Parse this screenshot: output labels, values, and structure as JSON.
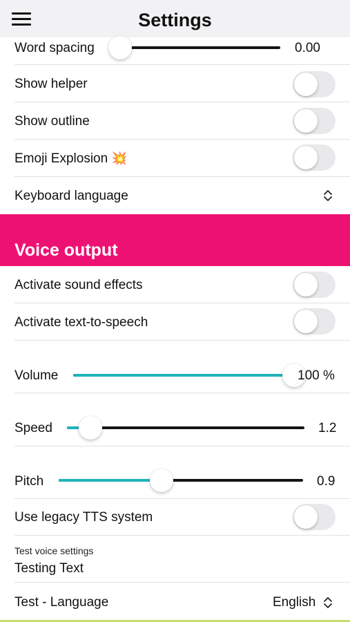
{
  "header": {
    "title": "Settings",
    "menu_icon": "hamburger-menu-icon"
  },
  "display": {
    "word_spacing": {
      "label": "Word spacing",
      "value_text": "0.00",
      "fraction": 0.05
    },
    "show_helper": {
      "label": "Show helper",
      "on": false
    },
    "show_outline": {
      "label": "Show outline",
      "on": false
    },
    "emoji_explosion": {
      "label": "Emoji Explosion",
      "emoji": "💥",
      "on": false
    },
    "keyboard_language": {
      "label": "Keyboard language",
      "value": ""
    }
  },
  "voice_output": {
    "section_title": "Voice output",
    "sound_effects": {
      "label": "Activate sound effects",
      "on": false
    },
    "tts": {
      "label": "Activate text-to-speech",
      "on": false
    },
    "volume": {
      "label": "Volume",
      "value_text": "100 %",
      "fraction": 1.0
    },
    "speed": {
      "label": "Speed",
      "value_text": "1.2",
      "fraction": 0.1
    },
    "pitch": {
      "label": "Pitch",
      "value_text": "0.9",
      "fraction": 0.42
    },
    "legacy_tts": {
      "label": "Use legacy TTS system",
      "on": false
    },
    "test_voice": {
      "label": "Test voice settings",
      "value": "Testing Text"
    },
    "test_language": {
      "label": "Test - Language",
      "value": "English"
    }
  },
  "colors": {
    "accent": "#ee1174",
    "slider_fill": "#1fb3b8",
    "slider_track": "#151515",
    "bottom_bar": "#c4de6b"
  }
}
